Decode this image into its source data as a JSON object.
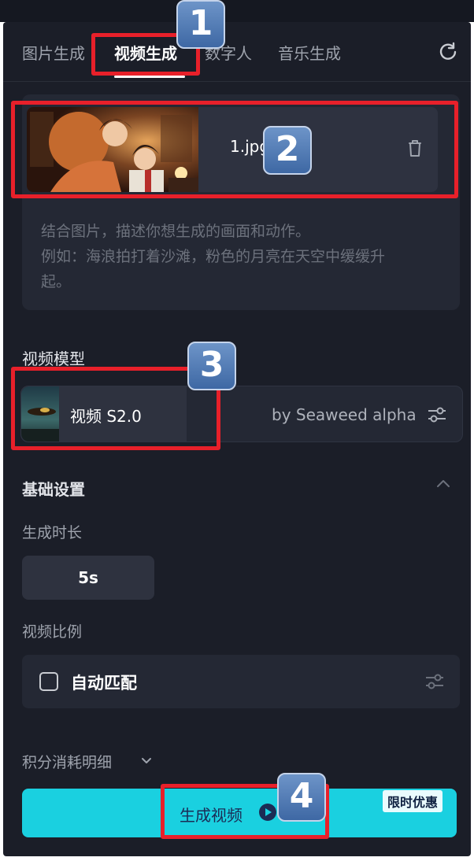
{
  "tabs": [
    {
      "label": "图片生成"
    },
    {
      "label": "视频生成"
    },
    {
      "label": "数字人"
    },
    {
      "label": "音乐生成"
    }
  ],
  "active_tab": "视频生成",
  "upload": {
    "file_name": "1.jpg",
    "prompt_placeholder_line1": "结合图片，描述你想生成的画面和动作。",
    "prompt_placeholder_line2": "例如：海浪拍打着沙滩，粉色的月亮在天空中缓缓升",
    "prompt_placeholder_line3": "起。"
  },
  "model": {
    "section_label": "视频模型",
    "name": "视频 S2.0",
    "provider": "by Seaweed alpha"
  },
  "basic_settings": {
    "label": "基础设置",
    "duration_label": "生成时长",
    "duration_value": "5s",
    "ratio_label": "视频比例",
    "ratio_value": "自动匹配"
  },
  "points_detail": "积分消耗明细",
  "generate": {
    "label": "生成视频",
    "promo": "限时优惠"
  },
  "annotations": [
    "1",
    "2",
    "3",
    "4"
  ],
  "colors": {
    "background": "#1b1e28",
    "accent_button": "#1ad0e0",
    "annotation_red": "#e8202a",
    "annotation_badge": "#4f78b6"
  }
}
